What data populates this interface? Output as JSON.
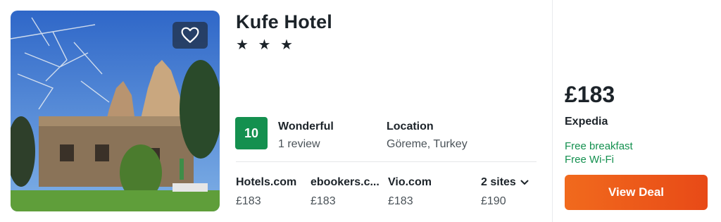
{
  "hotel": {
    "name": "Kufe Hotel",
    "stars": "★ ★ ★",
    "score": "10",
    "rating_word": "Wonderful",
    "review_count": "1 review",
    "location_label": "Location",
    "location_value": "Göreme, Turkey"
  },
  "sites": [
    {
      "name": "Hotels.com",
      "price": "£183"
    },
    {
      "name": "ebookers.c...",
      "price": "£183"
    },
    {
      "name": "Vio.com",
      "price": "£183"
    }
  ],
  "more_sites": {
    "label": "2 sites",
    "price": "£190"
  },
  "deal": {
    "price": "£183",
    "provider": "Expedia",
    "perks": [
      "Free breakfast",
      "Free Wi-Fi"
    ],
    "button_label": "View Deal"
  },
  "colors": {
    "score_green": "#14904f",
    "cta_orange": "#f16a1d",
    "perk_green": "#14904f"
  },
  "icons": {
    "favorite": "heart-icon",
    "more_sites": "chevron-down-icon"
  }
}
